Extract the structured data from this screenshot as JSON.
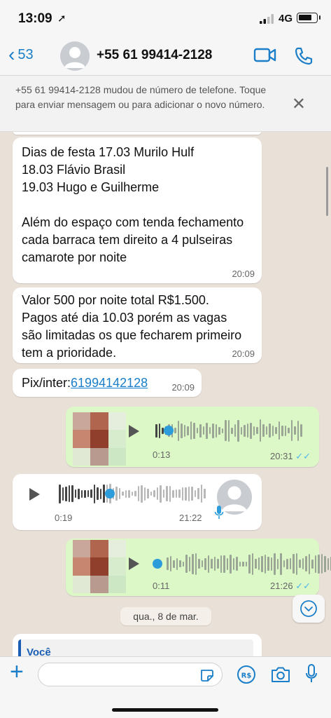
{
  "status_bar": {
    "time": "13:09",
    "location_glyph": "➚",
    "network": "4G"
  },
  "header": {
    "back_count": "53",
    "back_glyph": "‹",
    "contact": "+55 61 99414-2128",
    "accent": "#1a7ec8"
  },
  "banner": {
    "text": "+55 61 99414-2128 mudou de número de telefone. Toque para enviar mensagem ou para adicionar o novo número.",
    "close_glyph": "✕"
  },
  "messages": {
    "m1": {
      "text": "Dias de festa 17.03 Murilo Hulf\n18.03 Flávio Brasil\n19.03 Hugo e Guilherme\n\nAlém do espaço com tenda fechamento cada barraca tem direito a 4 pulseiras camarote   por noite",
      "time": "20:09"
    },
    "m2": {
      "text": "Valor 500 por noite total R$1.500. Pagos até dia 10.03 porém as vagas são limitadas os que fecharem primeiro tem a prioridade.",
      "time": "20:09"
    },
    "m3": {
      "prefix": "Pix/inter:",
      "link": "61994142128",
      "time": "20:09"
    },
    "v1": {
      "duration": "0:13",
      "time": "20:31",
      "ticks": "✓✓"
    },
    "v2": {
      "duration": "0:19",
      "time": "21:22"
    },
    "v3": {
      "duration": "0:11",
      "time": "21:26",
      "ticks": "✓✓"
    }
  },
  "date_chip": "qua., 8 de mar.",
  "reply_preview": {
    "author": "Você"
  },
  "input_bar": {
    "plus_glyph": "+",
    "placeholder": ""
  },
  "colors": {
    "chat_bg": "#e9e1d8",
    "outgoing": "#dcf8c6",
    "incoming": "#ffffff",
    "link": "#1a7ec8",
    "voice_dot": "#2c9cdb"
  }
}
